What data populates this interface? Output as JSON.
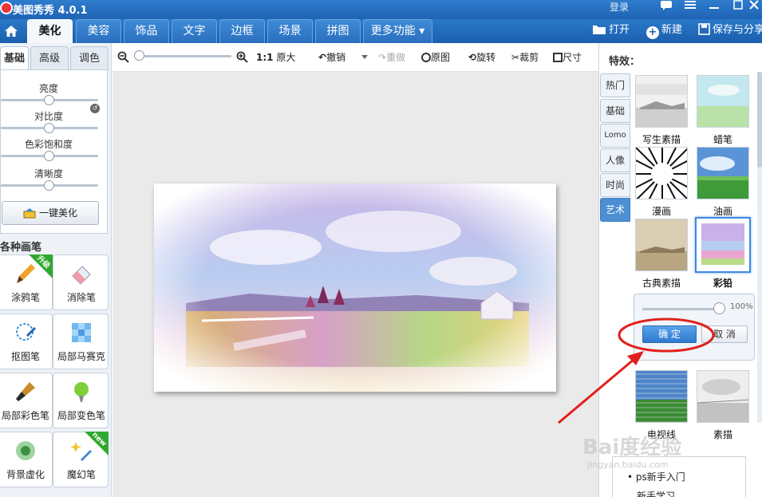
{
  "app": {
    "title": "美图秀秀 4.0.1",
    "login": "登录"
  },
  "nav": {
    "tabs": [
      "美化",
      "美容",
      "饰品",
      "文字",
      "边框",
      "场景",
      "拼图",
      "更多功能"
    ],
    "more_arrow": "▾",
    "actions": {
      "open": "打开",
      "new": "新建",
      "save": "保存与分享"
    }
  },
  "left": {
    "subtabs": [
      "基础",
      "高级",
      "调色"
    ],
    "sliders": [
      {
        "label": "亮度",
        "level": 0.5
      },
      {
        "label": "对比度",
        "level": 0.5
      },
      {
        "label": "色彩饱和度",
        "level": 0.5
      },
      {
        "label": "清晰度",
        "level": 0.5
      }
    ],
    "onekey": "一键美化",
    "brush_title": "各种画笔",
    "brushes": [
      {
        "label": "涂鸦笔",
        "badge": "升级"
      },
      {
        "label": "消除笔",
        "badge": ""
      },
      {
        "label": "抠图笔",
        "badge": ""
      },
      {
        "label": "局部马赛克",
        "badge": ""
      },
      {
        "label": "局部彩色笔",
        "badge": ""
      },
      {
        "label": "局部变色笔",
        "badge": ""
      },
      {
        "label": "背景虚化",
        "badge": ""
      },
      {
        "label": "魔幻笔",
        "badge": "new"
      }
    ]
  },
  "toolbar": {
    "ratio": "1:1",
    "original_size": "原大",
    "undo": "撤销",
    "redo": "重做",
    "original": "原图",
    "rotate": "旋转",
    "crop": "裁剪",
    "resize": "尺寸"
  },
  "right": {
    "title": "特效：",
    "categories": [
      "热门",
      "基础",
      "Lomo",
      "人像",
      "时尚",
      "艺术"
    ],
    "active_category": "艺术",
    "effects": [
      "写生素描",
      "蜡笔",
      "漫画",
      "油画",
      "古典素描",
      "彩铅",
      "电视线",
      "素描"
    ],
    "selected_effect": "彩铅",
    "popup": {
      "value": "100%",
      "level": 1.0,
      "ok": "确 定",
      "cancel": "取 消"
    },
    "bottom_card": {
      "line1": "• ps新手入门",
      "line2": "新手学习"
    }
  },
  "watermark": {
    "text": "Bai度经验",
    "url": "jingyan.baidu.com"
  },
  "colors": {
    "accent": "#1f63b4",
    "active_tab": "#4d8fd2",
    "annotation": "#e0201c"
  },
  "icons": [
    "home-icon",
    "folder-icon",
    "plus-circle-icon",
    "save-icon",
    "zoom-out-icon",
    "zoom-in-icon",
    "undo-icon",
    "redo-icon",
    "original-icon",
    "rotate-icon",
    "crop-icon",
    "resize-icon",
    "reset-icon",
    "minimize-icon",
    "maximize-icon",
    "close-icon",
    "chat-icon",
    "menu-icon"
  ]
}
